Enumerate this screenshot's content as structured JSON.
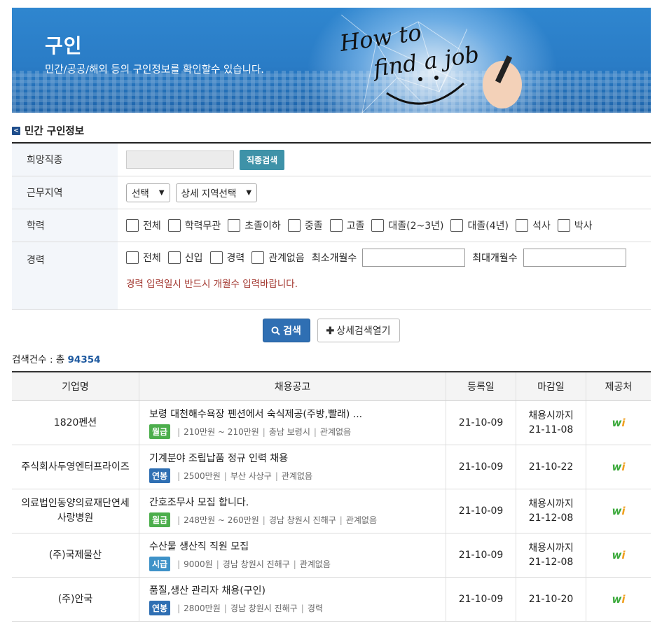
{
  "banner": {
    "title": "구인",
    "subtitle": "민간/공공/해외 등의 구인정보를 확인할수 있습니다.",
    "art_line1": "How to",
    "art_line2": "find a job"
  },
  "section": {
    "title": "민간 구인정보"
  },
  "form": {
    "job_label": "희망직종",
    "job_search_btn": "직종검색",
    "region_label": "근무지역",
    "region_select": "선택",
    "region_detail_select": "상세 지역선택",
    "edu_label": "학력",
    "edu_options": [
      "전체",
      "학력무관",
      "초졸이하",
      "중졸",
      "고졸",
      "대졸(2~3년)",
      "대졸(4년)",
      "석사",
      "박사"
    ],
    "exp_label": "경력",
    "exp_options": [
      "전체",
      "신입",
      "경력",
      "관계없음"
    ],
    "min_months_label": "최소개월수",
    "max_months_label": "최대개월수",
    "exp_warning": "경력 입력일시 반드시 개월수 입력바랍니다."
  },
  "buttons": {
    "search": "검색",
    "detail": "상세검색열기"
  },
  "result": {
    "count_label": "검색건수 : 총",
    "count": "94354"
  },
  "table": {
    "headers": [
      "기업명",
      "채용공고",
      "등록일",
      "마감일",
      "제공처"
    ],
    "rows": [
      {
        "company": "1820펜션",
        "title": "보령 대천해수욕장 펜션에서 숙식제공(주방,빨래) ...",
        "pay_type": "월급",
        "pay_color": "#4cae4c",
        "pay": "210만원 ~ 210만원",
        "region": "충남 보령시",
        "career": "관계없음",
        "reg": "21-10-09",
        "deadline1": "채용시까지",
        "deadline2": "21-11-08"
      },
      {
        "company": "주식회사두영엔터프라이즈",
        "title": "기계분야 조립납품 정규 인력 채용",
        "pay_type": "연봉",
        "pay_color": "#2f6fb3",
        "pay": "2500만원",
        "region": "부산 사상구",
        "career": "관계없음",
        "reg": "21-10-09",
        "deadline1": "21-10-22",
        "deadline2": ""
      },
      {
        "company": "의료법인동양의료재단연세사랑병원",
        "title": "간호조무사 모집 합니다.",
        "pay_type": "월급",
        "pay_color": "#4cae4c",
        "pay": "248만원 ~ 260만원",
        "region": "경남 창원시 진해구",
        "career": "관계없음",
        "reg": "21-10-09",
        "deadline1": "채용시까지",
        "deadline2": "21-12-08"
      },
      {
        "company": "(주)국제물산",
        "title": "수산물 생산직 직원 모집",
        "pay_type": "시급",
        "pay_color": "#3e92c8",
        "pay": "9000원",
        "region": "경남 창원시 진해구",
        "career": "관계없음",
        "reg": "21-10-09",
        "deadline1": "채용시까지",
        "deadline2": "21-12-08"
      },
      {
        "company": "(주)안국",
        "title": "품질,생산 관리자 채용(구인)",
        "pay_type": "연봉",
        "pay_color": "#2f6fb3",
        "pay": "2800만원",
        "region": "경남 창원시 진해구",
        "career": "경력",
        "reg": "21-10-09",
        "deadline1": "21-10-20",
        "deadline2": ""
      }
    ]
  }
}
